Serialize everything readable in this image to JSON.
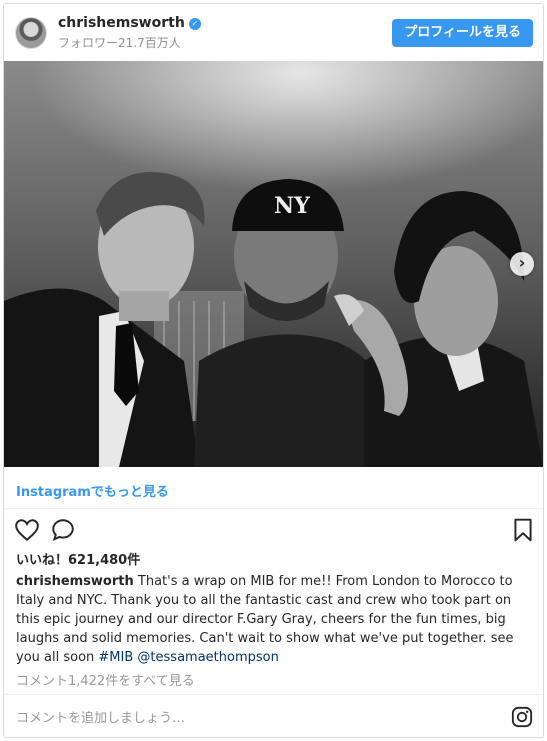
{
  "header": {
    "username": "chrishemsworth",
    "verified_mark": "✓",
    "followers": "フォロワー21.7百万人",
    "profile_button": "プロフィールを見る"
  },
  "photo": {
    "next_icon": "chevron-right-icon",
    "next_glyph": "›"
  },
  "more": {
    "link_text": "Instagramでもっと見る"
  },
  "actions": {
    "like_icon": "heart-icon",
    "comment_icon": "comment-icon",
    "save_icon": "bookmark-icon"
  },
  "likes": {
    "label": "いいね！621,480件"
  },
  "caption": {
    "username": "chrishemsworth",
    "text": " That's a wrap on MIB for me!! From London to Morocco to Italy and NYC. Thank you to all the fantastic cast and crew who took part on this epic journey and our director F.Gary Gray, cheers for the fun times, big laughs and solid memories. Can't wait to show what we've put together. see you all soon ",
    "hashtag": "#MIB",
    "mention": "@tessamaethompson"
  },
  "comments": {
    "view_all": "コメント1,422件をすべて見る",
    "input_placeholder": "コメントを追加しましょう…"
  },
  "colors": {
    "accent": "#3897f0",
    "muted": "#8e8e8e",
    "border": "#dbdbdb",
    "text": "#262626"
  }
}
